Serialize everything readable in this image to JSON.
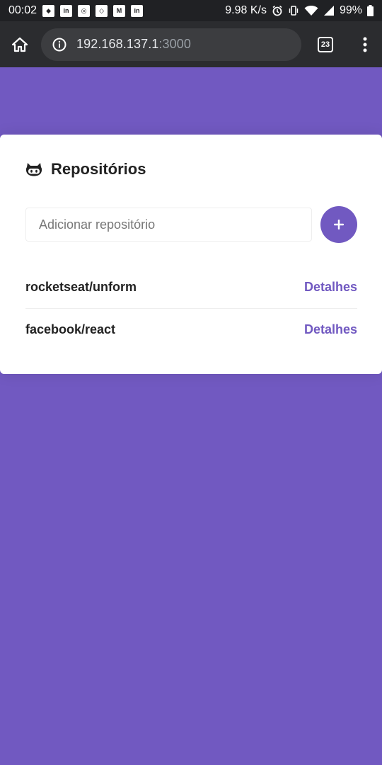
{
  "status_bar": {
    "time": "00:02",
    "net_speed": "9.98 K/s",
    "battery": "99%",
    "notification_icons": [
      "discord-icon",
      "linkedin-icon",
      "instagram-icon",
      "app-icon",
      "gmail-icon",
      "linkedin-icon"
    ]
  },
  "browser": {
    "url_host": "192.168.137.1",
    "url_port": ":3000",
    "tab_count": "23"
  },
  "card": {
    "title": "Repositórios",
    "input_placeholder": "Adicionar repositório",
    "input_value": "",
    "repositories": [
      {
        "name": "rocketseat/unform",
        "link": "Detalhes"
      },
      {
        "name": "facebook/react",
        "link": "Detalhes"
      }
    ]
  },
  "colors": {
    "background": "#7159c1",
    "accent": "#7159c1",
    "card": "#ffffff"
  }
}
